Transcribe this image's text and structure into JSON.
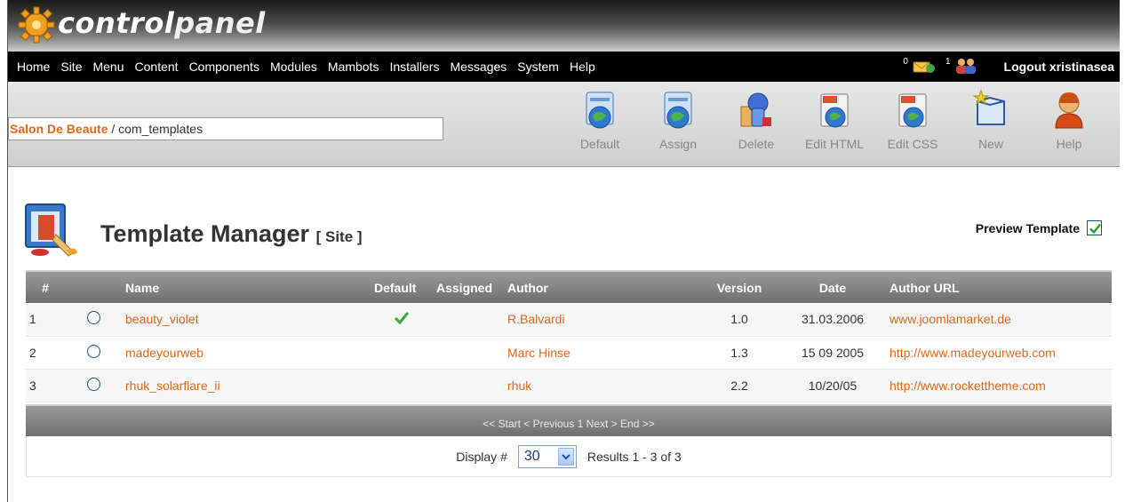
{
  "app": {
    "logo_text_a": "control",
    "logo_text_b": "panel"
  },
  "menu": {
    "items": [
      "Home",
      "Site",
      "Menu",
      "Content",
      "Components",
      "Modules",
      "Mambots",
      "Installers",
      "Messages",
      "System",
      "Help"
    ],
    "messages_count": "0",
    "users_count": "1",
    "logout_label": "Logout xristinasea"
  },
  "pathway": {
    "site": "Salon De Beaute",
    "separator": " / ",
    "component": "com_templates"
  },
  "toolbar": {
    "default_label": "Default",
    "assign_label": "Assign",
    "delete_label": "Delete",
    "edit_html_label": "Edit HTML",
    "edit_css_label": "Edit CSS",
    "new_label": "New",
    "help_label": "Help"
  },
  "page": {
    "title": "Template Manager",
    "subtitle": "[ Site ]",
    "preview_label": "Preview Template",
    "preview_checked": true
  },
  "table": {
    "headers": [
      "#",
      "",
      "Name",
      "Default",
      "Assigned",
      "Author",
      "Version",
      "Date",
      "Author URL"
    ],
    "rows": [
      {
        "num": "1",
        "name": "beauty_violet",
        "default": true,
        "assigned": false,
        "author": "R.Balvardi",
        "version": "1.0",
        "date": "31.03.2006",
        "url": "www.joomlamarket.de"
      },
      {
        "num": "2",
        "name": "madeyourweb",
        "default": false,
        "assigned": false,
        "author": "Marc Hinse",
        "version": "1.3",
        "date": "15 09 2005",
        "url": "http://www.madeyourweb.com"
      },
      {
        "num": "3",
        "name": "rhuk_solarflare_ii",
        "default": false,
        "assigned": false,
        "author": "rhuk",
        "version": "2.2",
        "date": "10/20/05",
        "url": "http://www.rockettheme.com"
      }
    ]
  },
  "pagination": {
    "text": "<< Start < Previous 1 Next > End >>",
    "display_label": "Display #",
    "display_value": "30",
    "results": "Results 1 - 3 of 3"
  },
  "colors": {
    "link": "#e06818",
    "header_bg": "#7a7a7a",
    "menubar_bg": "#000000"
  }
}
